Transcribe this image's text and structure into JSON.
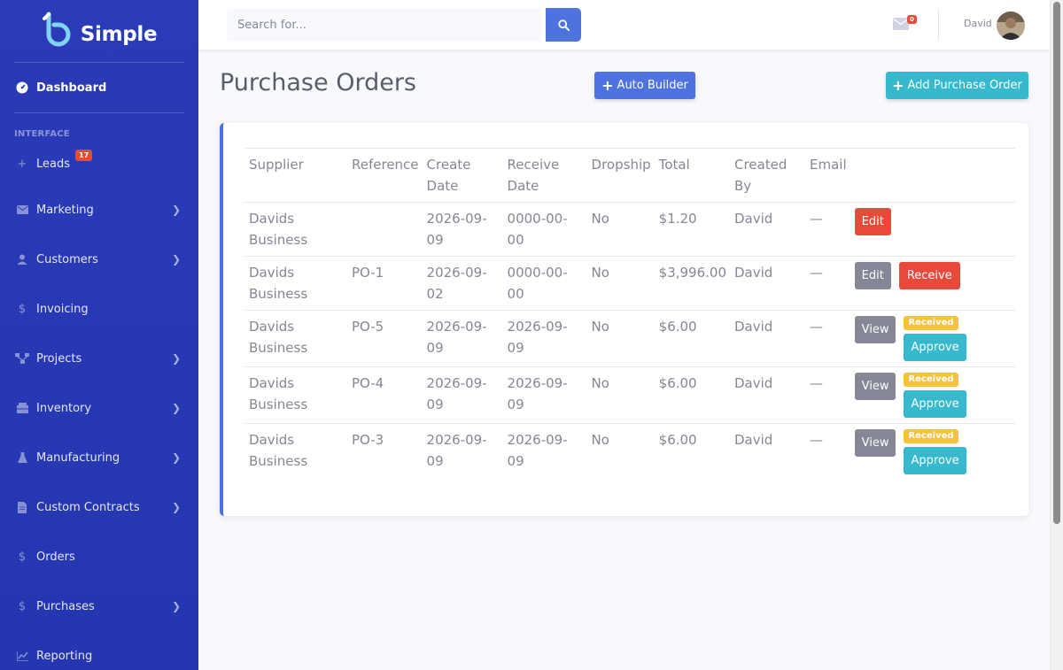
{
  "brand": {
    "name": "Simple"
  },
  "sidebar": {
    "dashboard": "Dashboard",
    "section": "INTERFACE",
    "items": [
      {
        "label": "Leads",
        "icon": "plus-icon",
        "badge": "17",
        "has_arrow": false
      },
      {
        "label": "Marketing",
        "icon": "envelope-icon",
        "has_arrow": true
      },
      {
        "label": "Customers",
        "icon": "user-icon",
        "has_arrow": true
      },
      {
        "label": "Invoicing",
        "icon": "dollar-icon",
        "has_arrow": false
      },
      {
        "label": "Projects",
        "icon": "sitemap-icon",
        "has_arrow": true
      },
      {
        "label": "Inventory",
        "icon": "warehouse-icon",
        "has_arrow": true
      },
      {
        "label": "Manufacturing",
        "icon": "flask-icon",
        "has_arrow": true
      },
      {
        "label": "Custom Contracts",
        "icon": "file-icon",
        "has_arrow": true
      },
      {
        "label": "Orders",
        "icon": "dollar-icon",
        "has_arrow": false
      },
      {
        "label": "Purchases",
        "icon": "dollar-icon",
        "has_arrow": true
      },
      {
        "label": "Reporting",
        "icon": "chart-icon",
        "has_arrow": false
      }
    ]
  },
  "topbar": {
    "search_placeholder": "Search for...",
    "mail_badge": "0",
    "user_name": "David"
  },
  "page": {
    "title": "Purchase Orders",
    "auto_builder": "Auto Builder",
    "add_po": "Add Purchase Order"
  },
  "table": {
    "headers": [
      "Supplier",
      "Reference",
      "Create Date",
      "Receive Date",
      "Dropship",
      "Total",
      "Created By",
      "Email"
    ],
    "rows": [
      {
        "supplier": "Davids Business",
        "reference": "",
        "create_date": "2026-09-09",
        "receive_date": "0000-00-00",
        "dropship": "No",
        "total": "$1.20",
        "created_by": "David",
        "email": "—",
        "actions": [
          "Edit"
        ],
        "status": ""
      },
      {
        "supplier": "Davids Business",
        "reference": "PO-1",
        "create_date": "2026-09-02",
        "receive_date": "0000-00-00",
        "dropship": "No",
        "total": "$3,996.00",
        "created_by": "David",
        "email": "—",
        "actions": [
          "Edit",
          "Receive"
        ],
        "status": ""
      },
      {
        "supplier": "Davids Business",
        "reference": "PO-5",
        "create_date": "2026-09-09",
        "receive_date": "2026-09-09",
        "dropship": "No",
        "total": "$6.00",
        "created_by": "David",
        "email": "—",
        "actions": [
          "View",
          "Approve"
        ],
        "status": "Received"
      },
      {
        "supplier": "Davids Business",
        "reference": "PO-4",
        "create_date": "2026-09-09",
        "receive_date": "2026-09-09",
        "dropship": "No",
        "total": "$6.00",
        "created_by": "David",
        "email": "—",
        "actions": [
          "View",
          "Approve"
        ],
        "status": "Received"
      },
      {
        "supplier": "Davids Business",
        "reference": "PO-3",
        "create_date": "2026-09-09",
        "receive_date": "2026-09-09",
        "dropship": "No",
        "total": "$6.00",
        "created_by": "David",
        "email": "—",
        "actions": [
          "View",
          "Approve"
        ],
        "status": "Received"
      }
    ]
  },
  "colors": {
    "primary": "#4e73df",
    "info": "#36b9cc",
    "danger": "#e74a3b",
    "warning": "#f6c23e",
    "secondary": "#858796",
    "sidebar": "#2b3bb8"
  }
}
